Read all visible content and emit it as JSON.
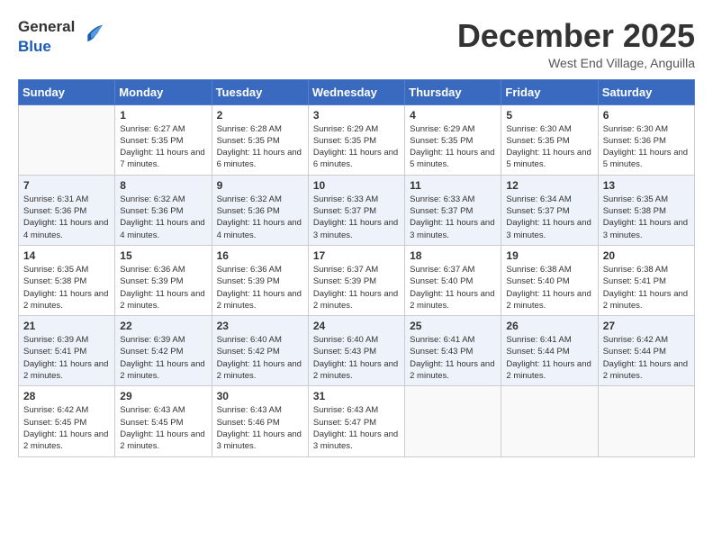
{
  "header": {
    "logo_general": "General",
    "logo_blue": "Blue",
    "month_title": "December 2025",
    "subtitle": "West End Village, Anguilla"
  },
  "days_of_week": [
    "Sunday",
    "Monday",
    "Tuesday",
    "Wednesday",
    "Thursday",
    "Friday",
    "Saturday"
  ],
  "weeks": [
    [
      {
        "day": "",
        "sunrise": "",
        "sunset": "",
        "daylight": ""
      },
      {
        "day": "1",
        "sunrise": "Sunrise: 6:27 AM",
        "sunset": "Sunset: 5:35 PM",
        "daylight": "Daylight: 11 hours and 7 minutes."
      },
      {
        "day": "2",
        "sunrise": "Sunrise: 6:28 AM",
        "sunset": "Sunset: 5:35 PM",
        "daylight": "Daylight: 11 hours and 6 minutes."
      },
      {
        "day": "3",
        "sunrise": "Sunrise: 6:29 AM",
        "sunset": "Sunset: 5:35 PM",
        "daylight": "Daylight: 11 hours and 6 minutes."
      },
      {
        "day": "4",
        "sunrise": "Sunrise: 6:29 AM",
        "sunset": "Sunset: 5:35 PM",
        "daylight": "Daylight: 11 hours and 5 minutes."
      },
      {
        "day": "5",
        "sunrise": "Sunrise: 6:30 AM",
        "sunset": "Sunset: 5:35 PM",
        "daylight": "Daylight: 11 hours and 5 minutes."
      },
      {
        "day": "6",
        "sunrise": "Sunrise: 6:30 AM",
        "sunset": "Sunset: 5:36 PM",
        "daylight": "Daylight: 11 hours and 5 minutes."
      }
    ],
    [
      {
        "day": "7",
        "sunrise": "Sunrise: 6:31 AM",
        "sunset": "Sunset: 5:36 PM",
        "daylight": "Daylight: 11 hours and 4 minutes."
      },
      {
        "day": "8",
        "sunrise": "Sunrise: 6:32 AM",
        "sunset": "Sunset: 5:36 PM",
        "daylight": "Daylight: 11 hours and 4 minutes."
      },
      {
        "day": "9",
        "sunrise": "Sunrise: 6:32 AM",
        "sunset": "Sunset: 5:36 PM",
        "daylight": "Daylight: 11 hours and 4 minutes."
      },
      {
        "day": "10",
        "sunrise": "Sunrise: 6:33 AM",
        "sunset": "Sunset: 5:37 PM",
        "daylight": "Daylight: 11 hours and 3 minutes."
      },
      {
        "day": "11",
        "sunrise": "Sunrise: 6:33 AM",
        "sunset": "Sunset: 5:37 PM",
        "daylight": "Daylight: 11 hours and 3 minutes."
      },
      {
        "day": "12",
        "sunrise": "Sunrise: 6:34 AM",
        "sunset": "Sunset: 5:37 PM",
        "daylight": "Daylight: 11 hours and 3 minutes."
      },
      {
        "day": "13",
        "sunrise": "Sunrise: 6:35 AM",
        "sunset": "Sunset: 5:38 PM",
        "daylight": "Daylight: 11 hours and 3 minutes."
      }
    ],
    [
      {
        "day": "14",
        "sunrise": "Sunrise: 6:35 AM",
        "sunset": "Sunset: 5:38 PM",
        "daylight": "Daylight: 11 hours and 2 minutes."
      },
      {
        "day": "15",
        "sunrise": "Sunrise: 6:36 AM",
        "sunset": "Sunset: 5:39 PM",
        "daylight": "Daylight: 11 hours and 2 minutes."
      },
      {
        "day": "16",
        "sunrise": "Sunrise: 6:36 AM",
        "sunset": "Sunset: 5:39 PM",
        "daylight": "Daylight: 11 hours and 2 minutes."
      },
      {
        "day": "17",
        "sunrise": "Sunrise: 6:37 AM",
        "sunset": "Sunset: 5:39 PM",
        "daylight": "Daylight: 11 hours and 2 minutes."
      },
      {
        "day": "18",
        "sunrise": "Sunrise: 6:37 AM",
        "sunset": "Sunset: 5:40 PM",
        "daylight": "Daylight: 11 hours and 2 minutes."
      },
      {
        "day": "19",
        "sunrise": "Sunrise: 6:38 AM",
        "sunset": "Sunset: 5:40 PM",
        "daylight": "Daylight: 11 hours and 2 minutes."
      },
      {
        "day": "20",
        "sunrise": "Sunrise: 6:38 AM",
        "sunset": "Sunset: 5:41 PM",
        "daylight": "Daylight: 11 hours and 2 minutes."
      }
    ],
    [
      {
        "day": "21",
        "sunrise": "Sunrise: 6:39 AM",
        "sunset": "Sunset: 5:41 PM",
        "daylight": "Daylight: 11 hours and 2 minutes."
      },
      {
        "day": "22",
        "sunrise": "Sunrise: 6:39 AM",
        "sunset": "Sunset: 5:42 PM",
        "daylight": "Daylight: 11 hours and 2 minutes."
      },
      {
        "day": "23",
        "sunrise": "Sunrise: 6:40 AM",
        "sunset": "Sunset: 5:42 PM",
        "daylight": "Daylight: 11 hours and 2 minutes."
      },
      {
        "day": "24",
        "sunrise": "Sunrise: 6:40 AM",
        "sunset": "Sunset: 5:43 PM",
        "daylight": "Daylight: 11 hours and 2 minutes."
      },
      {
        "day": "25",
        "sunrise": "Sunrise: 6:41 AM",
        "sunset": "Sunset: 5:43 PM",
        "daylight": "Daylight: 11 hours and 2 minutes."
      },
      {
        "day": "26",
        "sunrise": "Sunrise: 6:41 AM",
        "sunset": "Sunset: 5:44 PM",
        "daylight": "Daylight: 11 hours and 2 minutes."
      },
      {
        "day": "27",
        "sunrise": "Sunrise: 6:42 AM",
        "sunset": "Sunset: 5:44 PM",
        "daylight": "Daylight: 11 hours and 2 minutes."
      }
    ],
    [
      {
        "day": "28",
        "sunrise": "Sunrise: 6:42 AM",
        "sunset": "Sunset: 5:45 PM",
        "daylight": "Daylight: 11 hours and 2 minutes."
      },
      {
        "day": "29",
        "sunrise": "Sunrise: 6:43 AM",
        "sunset": "Sunset: 5:45 PM",
        "daylight": "Daylight: 11 hours and 2 minutes."
      },
      {
        "day": "30",
        "sunrise": "Sunrise: 6:43 AM",
        "sunset": "Sunset: 5:46 PM",
        "daylight": "Daylight: 11 hours and 3 minutes."
      },
      {
        "day": "31",
        "sunrise": "Sunrise: 6:43 AM",
        "sunset": "Sunset: 5:47 PM",
        "daylight": "Daylight: 11 hours and 3 minutes."
      },
      {
        "day": "",
        "sunrise": "",
        "sunset": "",
        "daylight": ""
      },
      {
        "day": "",
        "sunrise": "",
        "sunset": "",
        "daylight": ""
      },
      {
        "day": "",
        "sunrise": "",
        "sunset": "",
        "daylight": ""
      }
    ]
  ]
}
